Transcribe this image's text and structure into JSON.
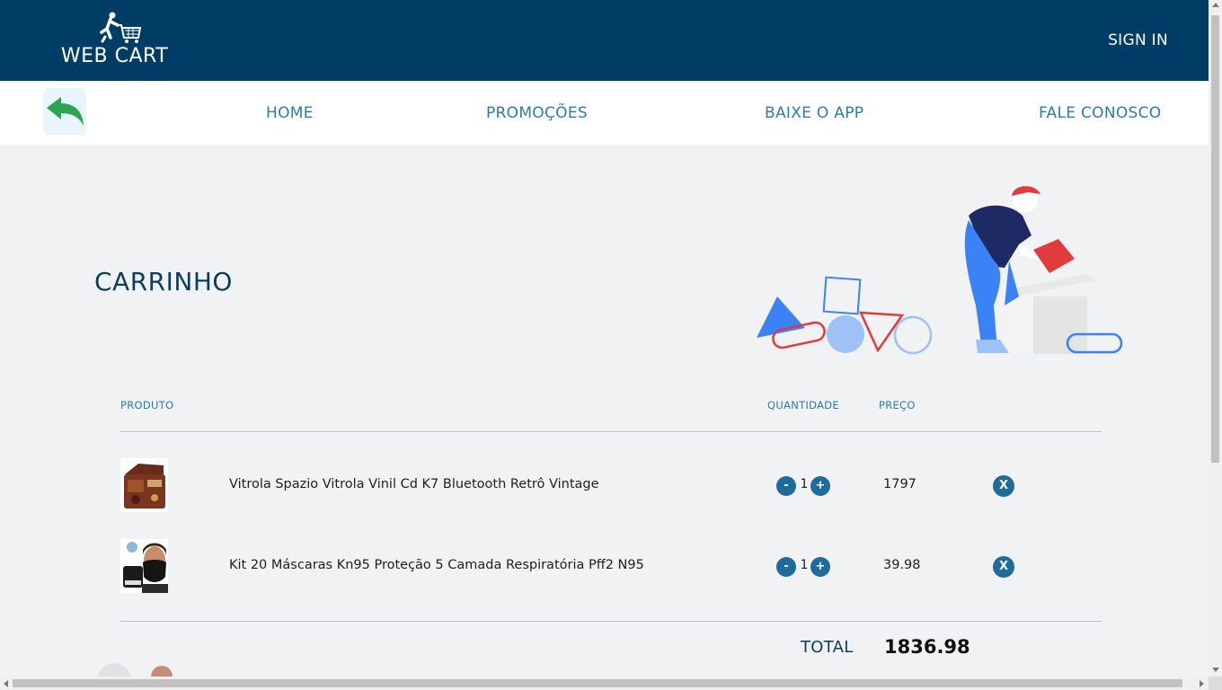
{
  "header": {
    "logo_text": "WEB CART",
    "logo_icon": "person-pushing-cart-icon",
    "signin_label": "SIGN IN"
  },
  "nav": {
    "back_icon": "back-arrow-icon",
    "links": [
      {
        "label": "HOME"
      },
      {
        "label": "PROMOÇÕES"
      },
      {
        "label": "BAIXE O APP"
      },
      {
        "label": "FALE CONOSCO"
      }
    ]
  },
  "cart": {
    "title": "CARRINHO",
    "columns": {
      "product": "PRODUTO",
      "quantity": "QUANTIDADE",
      "price": "PREÇO"
    },
    "items": [
      {
        "name": "Vitrola Spazio Vitrola Vinil Cd K7 Bluetooth Retrô Vintage",
        "quantity": "1",
        "price": "1797",
        "minus": "-",
        "plus": "+",
        "remove": "X"
      },
      {
        "name": "Kit 20 Máscaras Kn95 Proteção 5 Camada Respiratória Pff2 N95",
        "quantity": "1",
        "price": "39.98",
        "minus": "-",
        "plus": "+",
        "remove": "X"
      }
    ],
    "total_label": "TOTAL",
    "total_value": "1836.98"
  },
  "colors": {
    "header_bg": "#003d66",
    "nav_link": "#2b7bac",
    "title": "#0b3d5e",
    "button": "#1f6b9a",
    "page_bg": "#f1f2f4"
  }
}
